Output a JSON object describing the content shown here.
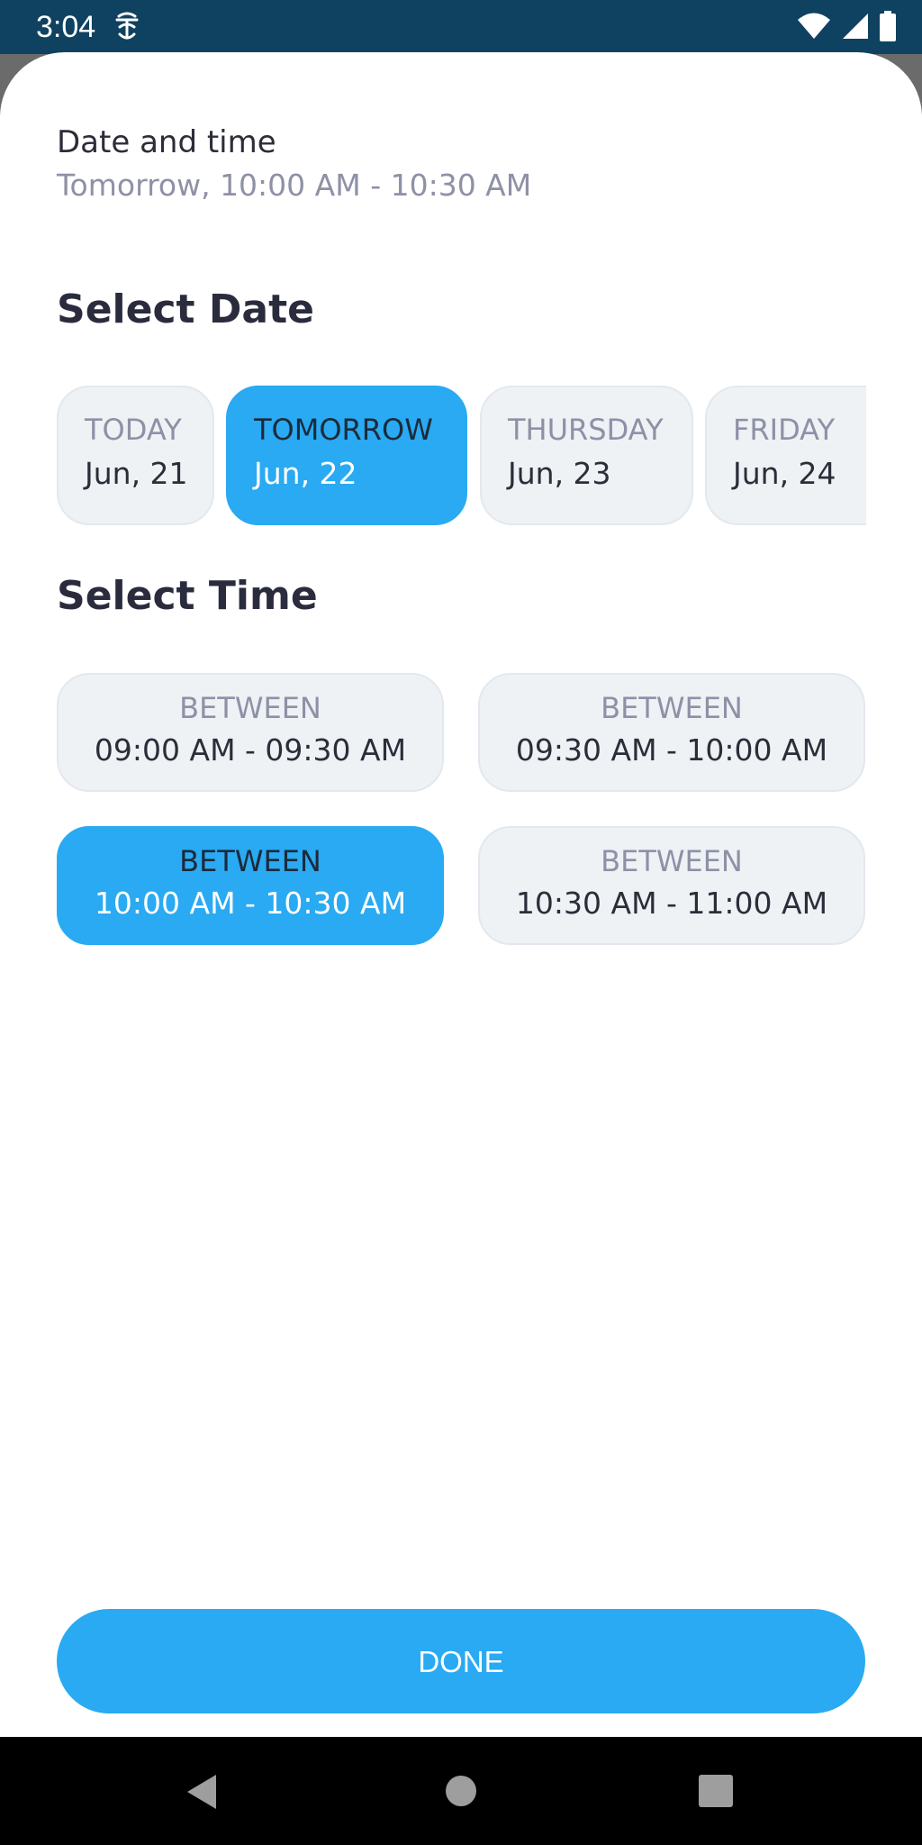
{
  "status_bar": {
    "time": "3:04",
    "app_icon": "notification-app-icon",
    "icons": [
      "wifi-icon",
      "signal-icon",
      "battery-icon"
    ],
    "background": "#0f4260"
  },
  "summary": {
    "label": "Date and time",
    "value": "Tomorrow, 10:00 AM - 10:30 AM"
  },
  "select_date": {
    "title": "Select Date",
    "dates": [
      {
        "day": "TODAY",
        "date": "Jun, 21",
        "selected": false
      },
      {
        "day": "TOMORROW",
        "date": "Jun, 22",
        "selected": true
      },
      {
        "day": "THURSDAY",
        "date": "Jun, 23",
        "selected": false
      },
      {
        "day": "FRIDAY",
        "date": "Jun, 24",
        "selected": false
      }
    ]
  },
  "select_time": {
    "title": "Select Time",
    "slots": [
      {
        "label": "BETWEEN",
        "range": "09:00 AM - 09:30 AM",
        "selected": false
      },
      {
        "label": "BETWEEN",
        "range": "09:30 AM - 10:00 AM",
        "selected": false
      },
      {
        "label": "BETWEEN",
        "range": "10:00 AM - 10:30 AM",
        "selected": true
      },
      {
        "label": "BETWEEN",
        "range": "10:30 AM - 11:00 AM",
        "selected": false
      }
    ]
  },
  "done_button": {
    "label": "DONE"
  },
  "colors": {
    "accent": "#29aaf2",
    "chip_background": "#eef2f5",
    "primary_text": "#2d2d3a",
    "secondary_text": "#8e91a6"
  },
  "nav_bar": {
    "icons": [
      "back-icon",
      "home-icon",
      "recents-icon"
    ]
  }
}
